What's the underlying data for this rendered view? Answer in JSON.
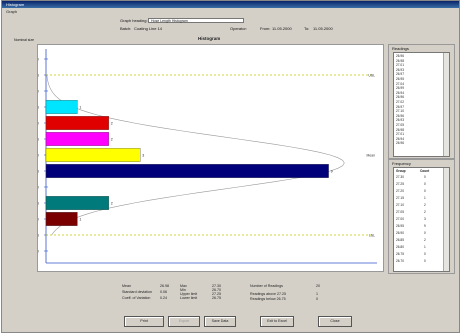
{
  "window": {
    "title": "Histogram",
    "menu": "Graph"
  },
  "header": {
    "graph_heading_label": "Graph heading:",
    "graph_heading_value": "Hose Length Histogram",
    "batch_label": "Batch:",
    "batch_value": "Coating Line 14",
    "operator_label": "Operator:",
    "from_label": "From:",
    "from_value": "11.05.2000",
    "to_label": "To:",
    "to_value": "11.05.2000"
  },
  "chart_panel": {
    "title": "Histogram",
    "axis_title": "Nominal size",
    "usl_label": "USL",
    "mean_label": "Mean",
    "lsl_label": "LSL"
  },
  "chart_data": {
    "type": "bar",
    "orientation": "horizontal",
    "categories": [
      "27.30",
      "27.25",
      "27.20",
      "27.15",
      "27.10",
      "27.05",
      "27.00",
      "26.95",
      "26.90",
      "26.85",
      "26.80",
      "26.75",
      "26.70"
    ],
    "values": [
      0,
      0,
      0,
      1,
      2,
      2,
      3,
      9,
      0,
      2,
      1,
      0,
      0
    ],
    "bar_colors": [
      "#00e5ff",
      "#e00000",
      "#ff00ff",
      "#ffff00",
      "#00007a",
      "#007a7a",
      "#7a0000"
    ],
    "xlim": [
      0,
      10
    ],
    "grid": false,
    "limit_lines": [
      {
        "name": "USL",
        "y": 27.25,
        "color": "#c8c800"
      },
      {
        "name": "LSL",
        "y": 26.75,
        "color": "#c8c800"
      }
    ],
    "normal_curve": true
  },
  "readings": {
    "title": "Readings",
    "items": [
      "26.96",
      "26.98",
      "27.01",
      "26.93",
      "26.97",
      "26.95",
      "27.04",
      "26.99",
      "26.94",
      "26.96",
      "27.02",
      "26.97",
      "27.10",
      "26.96",
      "26.93",
      "27.05",
      "26.98",
      "27.01",
      "26.94",
      "26.96"
    ]
  },
  "frequency": {
    "title": "Frequency",
    "col1": "Group",
    "col2": "Count",
    "rows": [
      [
        "27.30",
        "0"
      ],
      [
        "27.25",
        "0"
      ],
      [
        "27.20",
        "0"
      ],
      [
        "27.15",
        "1"
      ],
      [
        "27.10",
        "2"
      ],
      [
        "27.05",
        "2"
      ],
      [
        "27.00",
        "3"
      ],
      [
        "26.95",
        "9"
      ],
      [
        "26.90",
        "0"
      ],
      [
        "26.85",
        "2"
      ],
      [
        "26.80",
        "1"
      ],
      [
        "26.75",
        "0"
      ],
      [
        "26.70",
        "0"
      ]
    ]
  },
  "stats": {
    "mean_label": "Mean",
    "mean_value": "26.98",
    "std_label": "Standard deviation",
    "std_value": "0.06",
    "cov_label": "Coeff. of Variation",
    "cov_value": "0.24",
    "max_label": "Max",
    "max_value": "27.30",
    "min_label": "Min",
    "min_value": "26.70",
    "ul_label": "Upper limit",
    "ul_value": "27.25",
    "ll_label": "Lower limit",
    "ll_value": "26.75",
    "n_label": "Number of Readings",
    "n_value": "20",
    "above_label": "Readings above 27.25",
    "above_value": "1",
    "below_label": "Readings below 26.75",
    "below_value": "0"
  },
  "buttons": {
    "print": "Print",
    "disabled": "Export",
    "save": "Save Data",
    "exit": "Exit to Excel",
    "close": "Close"
  }
}
